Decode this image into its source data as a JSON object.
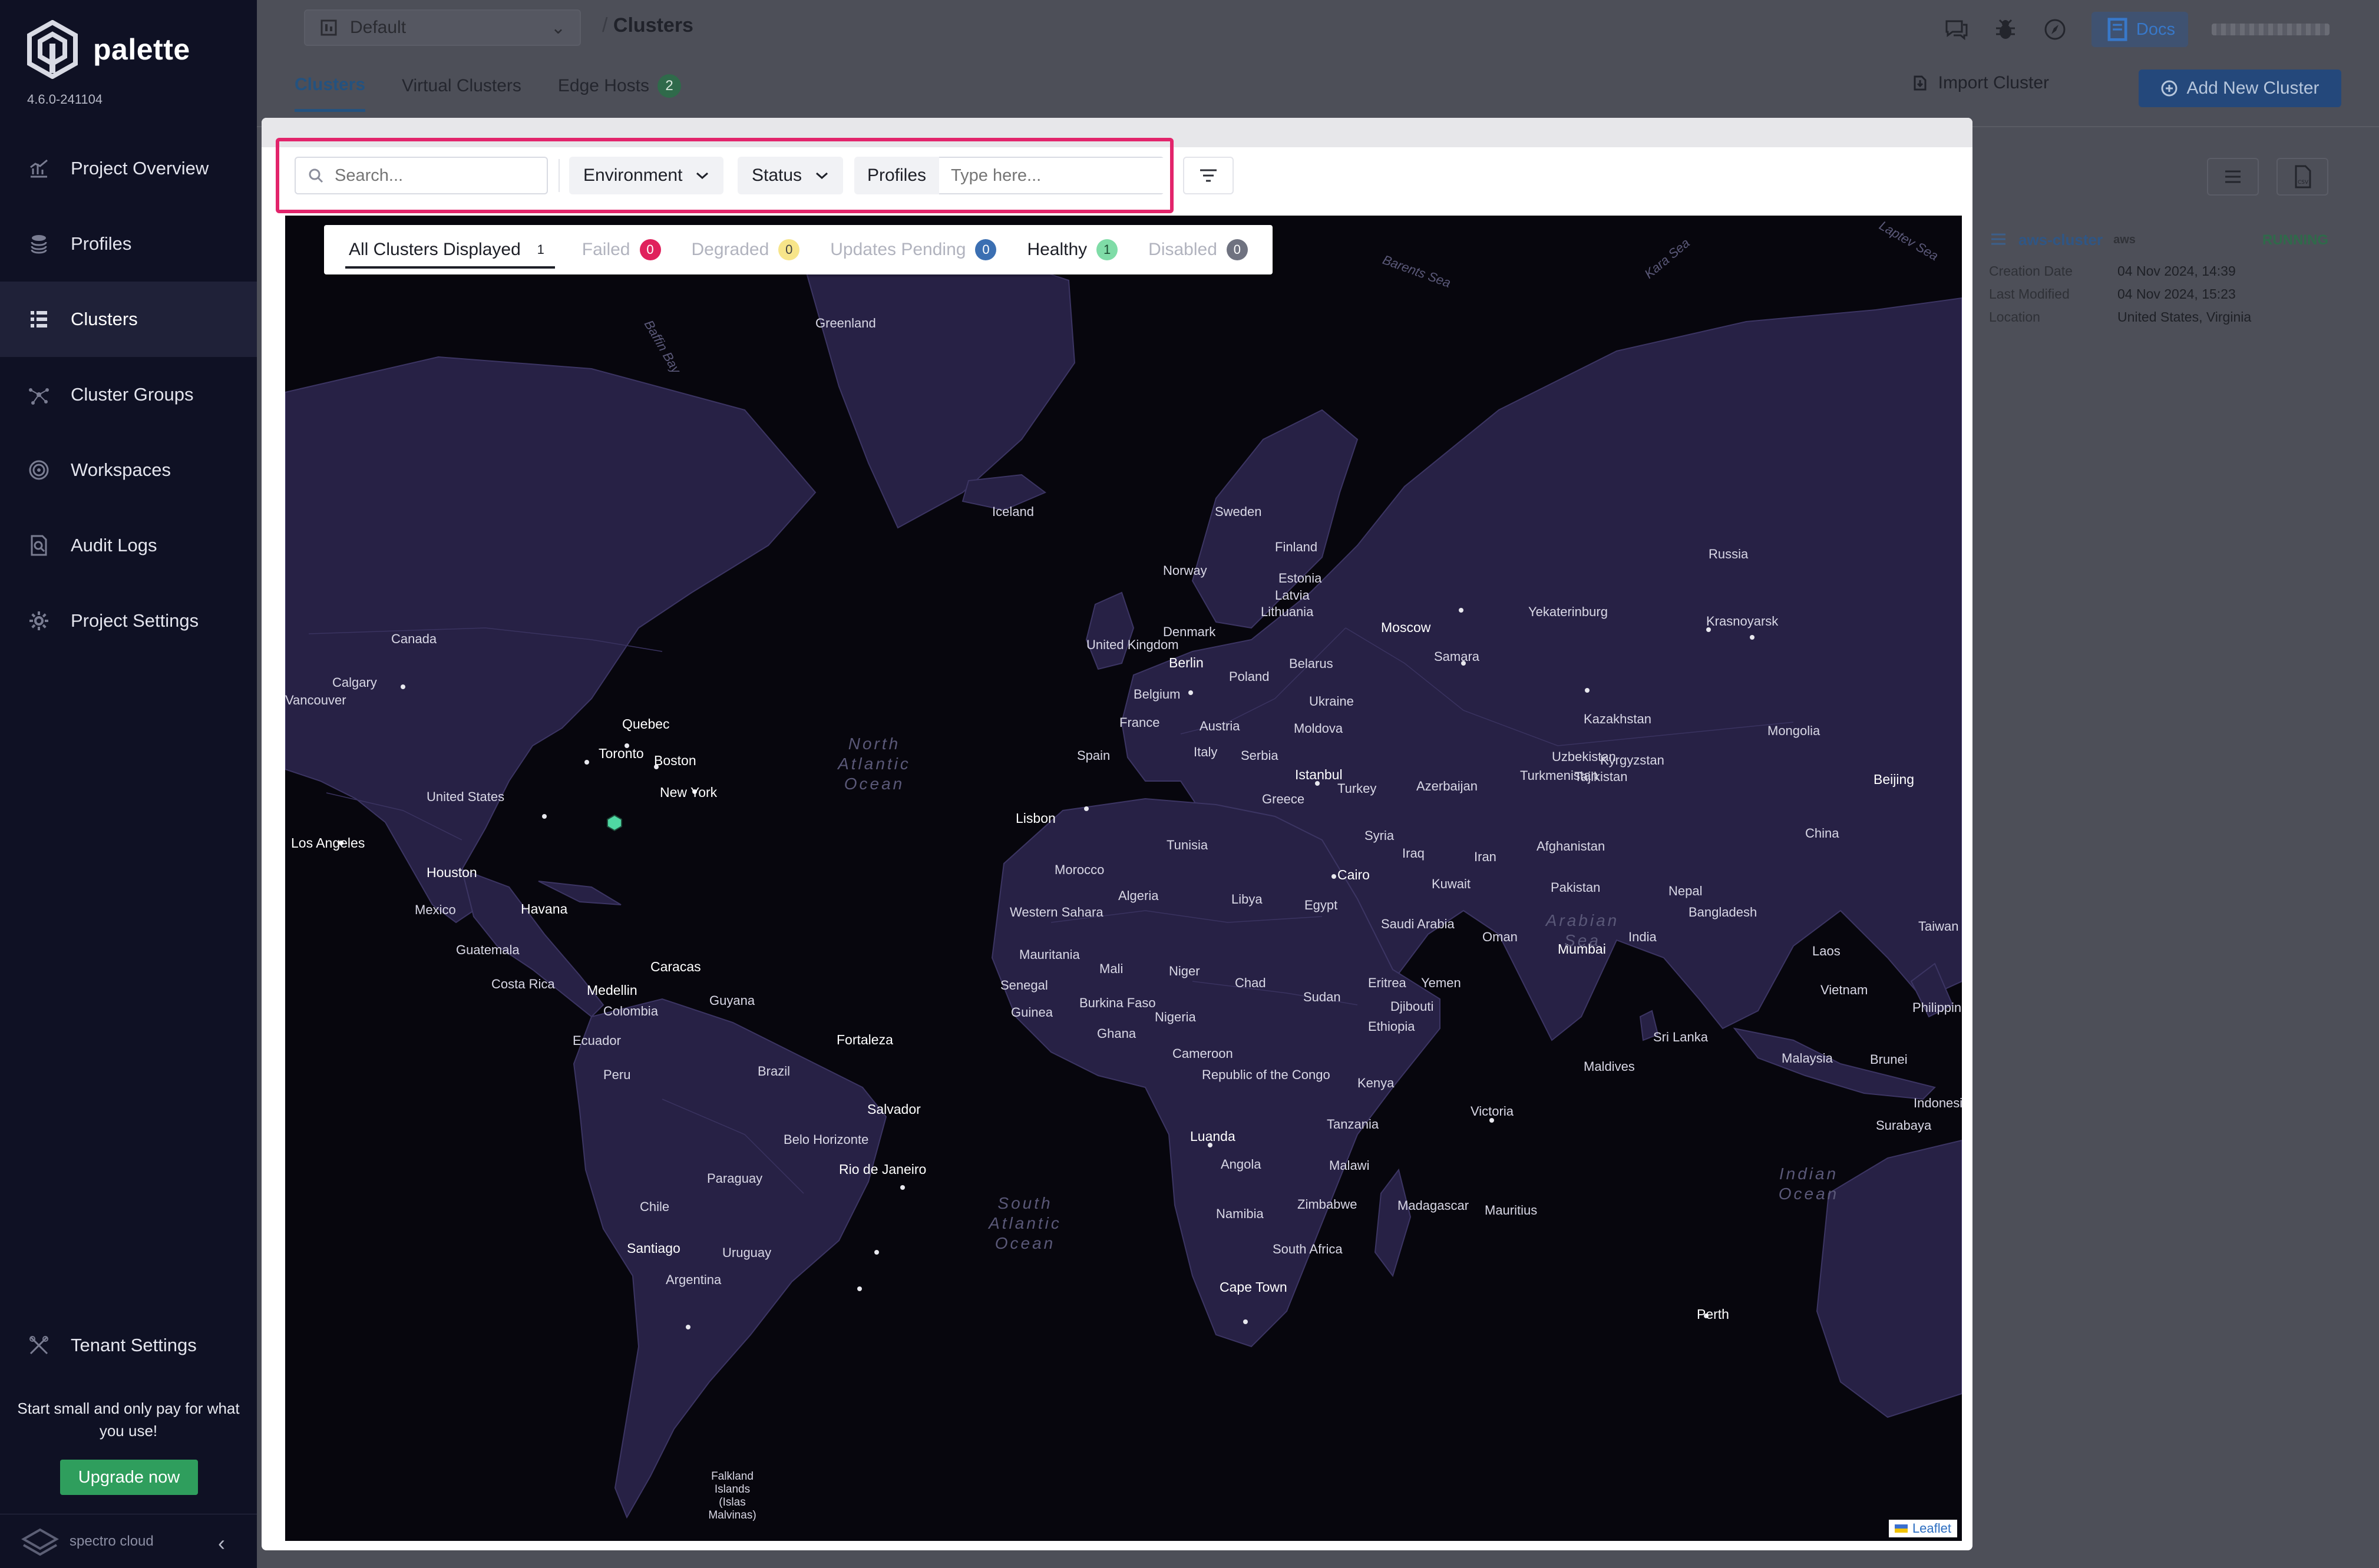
{
  "sidebar": {
    "brand": "palette",
    "version": "4.6.0-241104",
    "items": [
      {
        "label": "Project Overview",
        "icon": "chart-icon"
      },
      {
        "label": "Profiles",
        "icon": "stack-icon"
      },
      {
        "label": "Clusters",
        "icon": "clusters-icon"
      },
      {
        "label": "Cluster Groups",
        "icon": "network-icon"
      },
      {
        "label": "Workspaces",
        "icon": "target-icon"
      },
      {
        "label": "Audit Logs",
        "icon": "search-doc-icon"
      },
      {
        "label": "Project Settings",
        "icon": "gear-icon"
      }
    ],
    "tenant_settings": "Tenant Settings",
    "promo": "Start small and only pay for what you use!",
    "upgrade": "Upgrade now",
    "footer_brand": "spectro cloud"
  },
  "topbar": {
    "project": "Default",
    "breadcrumb_sep": "/",
    "breadcrumb": "Clusters",
    "docs": "Docs"
  },
  "tabs": [
    {
      "label": "Clusters",
      "active": true
    },
    {
      "label": "Virtual Clusters",
      "active": false
    },
    {
      "label": "Edge Hosts",
      "active": false,
      "count": "2"
    }
  ],
  "actions": {
    "import": "Import Cluster",
    "add": "Add New Cluster"
  },
  "cluster_card": {
    "name": "aws-cluster",
    "provider": "aws",
    "status": "RUNNING",
    "rows": [
      {
        "key": "Creation Date",
        "value": "04 Nov 2024, 14:39"
      },
      {
        "key": "Last Modified",
        "value": "04 Nov 2024, 15:23"
      },
      {
        "key": "Location",
        "value": "United States, Virginia"
      }
    ]
  },
  "filters": {
    "search_placeholder": "Search...",
    "environment": "Environment",
    "status": "Status",
    "profiles_label": "Profiles",
    "profiles_placeholder": "Type here..."
  },
  "status_tabs": [
    {
      "label": "All Clusters Displayed",
      "count": "1"
    },
    {
      "label": "Failed",
      "count": "0"
    },
    {
      "label": "Degraded",
      "count": "0"
    },
    {
      "label": "Updates Pending",
      "count": "0"
    },
    {
      "label": "Healthy",
      "count": "1"
    },
    {
      "label": "Disabled",
      "count": "0"
    }
  ],
  "map": {
    "attribution": "Leaflet",
    "labels": [
      "Greenland",
      "Iceland",
      "Sweden",
      "Finland",
      "Norway",
      "Estonia",
      "Latvia",
      "Lithuania",
      "Russia",
      "Moscow",
      "Yekaterinburg",
      "Krasnoyarsk",
      "Samara",
      "Denmark",
      "United Kingdom",
      "Berlin",
      "Poland",
      "Belarus",
      "Belgium",
      "Ukraine",
      "France",
      "Austria",
      "Moldova",
      "Kazakhstan",
      "Mongolia",
      "Spain",
      "Italy",
      "Serbia",
      "Istanbul",
      "Uzbekistan",
      "Kyrgyzstan",
      "Beijing",
      "Turkmenistan",
      "Tajikistan",
      "Turkey",
      "Azerbaijan",
      "Greece",
      "Lisbon",
      "Syria",
      "Iraq",
      "Iran",
      "Afghanistan",
      "China",
      "Tunisia",
      "Morocco",
      "Cairo",
      "Kuwait",
      "Pakistan",
      "Nepal",
      "Bangladesh",
      "Taiwan",
      "Algeria",
      "Libya",
      "Egypt",
      "Western Sahara",
      "Saudi Arabia",
      "Oman",
      "India",
      "Mumbai",
      "Laos",
      "Mauritania",
      "Mali",
      "Niger",
      "Chad",
      "Sudan",
      "Eritrea",
      "Yemen",
      "Senegal",
      "Burkina Faso",
      "Guinea",
      "Nigeria",
      "Djibouti",
      "Ghana",
      "Ethiopia",
      "Vietnam",
      "Philippines",
      "Cameroon",
      "Republic of the Congo",
      "Kenya",
      "Sri Lanka",
      "Malaysia",
      "Brunei",
      "Maldives",
      "Indonesia",
      "Surabaya",
      "Luanda",
      "Tanzania",
      "Victoria",
      "Angola",
      "Malawi",
      "Namibia",
      "Zimbabwe",
      "Madagascar",
      "Mauritius",
      "South Africa",
      "Cape Town",
      "Perth",
      "Canada",
      "Calgary",
      "Vancouver",
      "Quebec",
      "Toronto",
      "Boston",
      "United States",
      "New York",
      "Los Angeles",
      "Houston",
      "Mexico",
      "Havana",
      "Guatemala",
      "Costa Rica",
      "Caracas",
      "Medellin",
      "Colombia",
      "Guyana",
      "Ecuador",
      "Fortaleza",
      "Peru",
      "Brazil",
      "Salvador",
      "Belo Horizonte",
      "Rio de Janeiro",
      "Paraguay",
      "Chile",
      "Santiago",
      "Uruguay",
      "Argentina",
      "Falkland Islands (Islas Malvinas)",
      "Baffin Bay",
      "Barents Sea",
      "Kara Sea",
      "Laptev Sea"
    ],
    "oceans": [
      {
        "text": "North Atlantic Ocean"
      },
      {
        "text": "South Atlantic Ocean"
      },
      {
        "text": "Arabian Sea"
      },
      {
        "text": "Indian Ocean"
      }
    ]
  }
}
